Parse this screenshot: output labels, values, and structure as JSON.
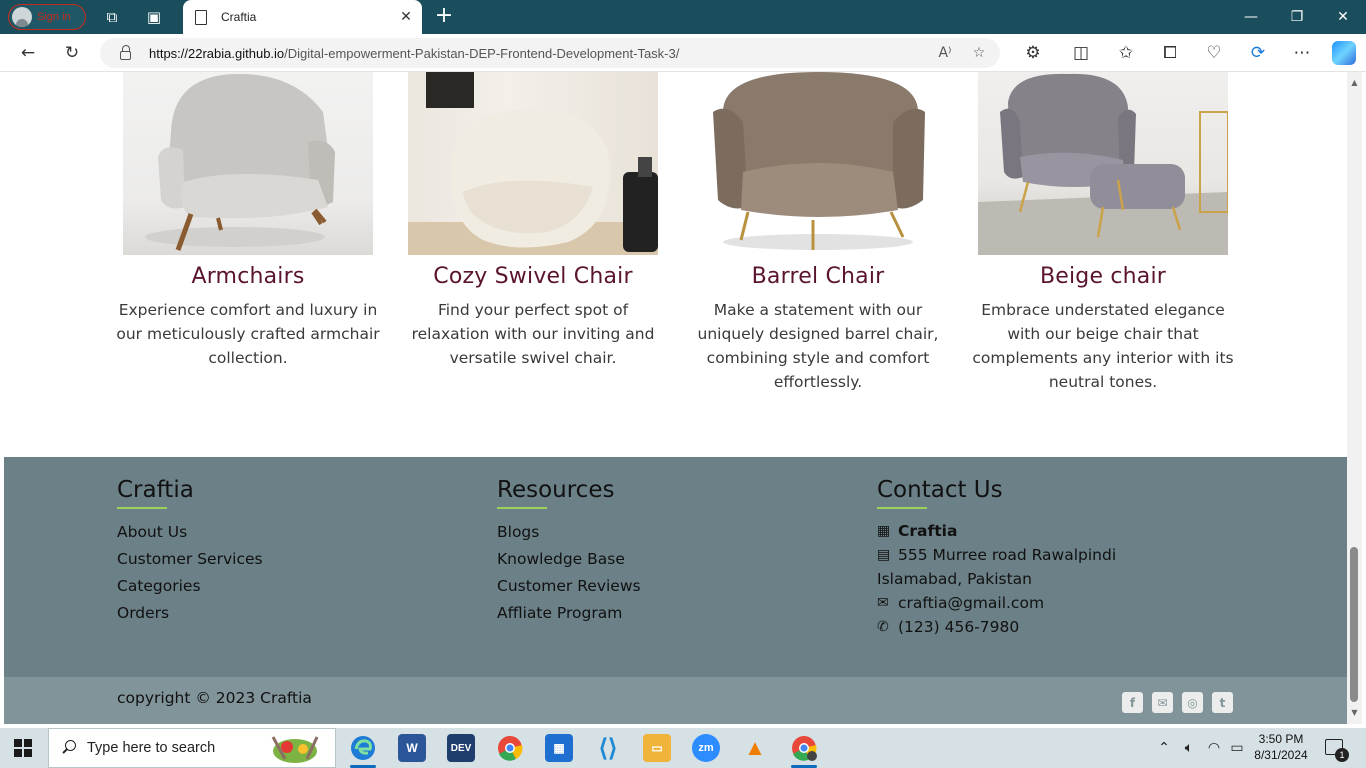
{
  "browser": {
    "profile_label": "Sign in",
    "tab_title": "Craftia",
    "url_host": "https://22rabia.github.io",
    "url_path": "/Digital-empowerment-Pakistan-DEP-Frontend-Development-Task-3/",
    "icons": [
      "workspaces-icon",
      "tab-actions-icon",
      "back-icon",
      "refresh-icon",
      "lock-icon",
      "read-aloud-icon",
      "favorite-star-icon",
      "extensions-icon",
      "split-screen-icon",
      "favorites-icon",
      "collections-icon",
      "browser-essentials-icon",
      "edge-bar-icon",
      "more-icon",
      "copilot-icon"
    ]
  },
  "products": [
    {
      "title": "Armchairs",
      "description": "Experience comfort and luxury in our meticulously crafted armchair collection."
    },
    {
      "title": "Cozy Swivel Chair",
      "description": "Find your perfect spot of relaxation with our inviting and versatile swivel chair."
    },
    {
      "title": "Barrel Chair",
      "description": "Make a statement with our uniquely designed barrel chair, combining style and comfort effortlessly."
    },
    {
      "title": "Beige chair",
      "description": "Embrace understated elegance with our beige chair that complements any interior with its neutral tones."
    }
  ],
  "footer": {
    "brand": {
      "heading": "Craftia",
      "links": [
        "About Us",
        "Customer Services",
        "Categories",
        "Orders"
      ]
    },
    "resources": {
      "heading": "Resources",
      "links": [
        "Blogs",
        "Knowledge Base",
        "Customer Reviews",
        "Affliate Program"
      ]
    },
    "contact": {
      "heading": "Contact Us",
      "company": "Craftia",
      "address_line1": "555 Murree road Rawalpindi",
      "address_line2": "Islamabad, Pakistan",
      "email": "craftia@gmail.com",
      "phone": "(123) 456-7980"
    },
    "copyright": "copyright © 2023 Craftia",
    "social": [
      "facebook-icon",
      "email-icon",
      "instagram-icon",
      "twitter-icon"
    ]
  },
  "taskbar": {
    "search_placeholder": "Type here to search",
    "time": "3:50 PM",
    "date": "8/31/2024",
    "notification_count": "1",
    "apps": [
      {
        "name": "Edge",
        "label": "e",
        "color": "#1e7bd6"
      },
      {
        "name": "Word",
        "label": "W",
        "color": "#2b579a"
      },
      {
        "name": "DEV",
        "label": "DEV",
        "color": "#1f3d6d"
      },
      {
        "name": "Chrome",
        "label": "",
        "color": "#e7483a"
      },
      {
        "name": "Store",
        "label": "",
        "color": "#1f6fd0"
      },
      {
        "name": "VS Code",
        "label": "",
        "color": "#1f8ad2"
      },
      {
        "name": "Explorer",
        "label": "",
        "color": "#f0b43a"
      },
      {
        "name": "Zoom",
        "label": "zm",
        "color": "#2d8cff"
      },
      {
        "name": "VLC",
        "label": "",
        "color": "#ef7d00"
      },
      {
        "name": "Chrome Profile",
        "label": "",
        "color": "#e7483a"
      }
    ]
  },
  "colors": {
    "titlebar": "#1a4e5c",
    "footer_bg": "#6b8087",
    "footer_bottom": "#819499",
    "product_title": "#5a1430",
    "accent_line": "#9bd35a"
  }
}
